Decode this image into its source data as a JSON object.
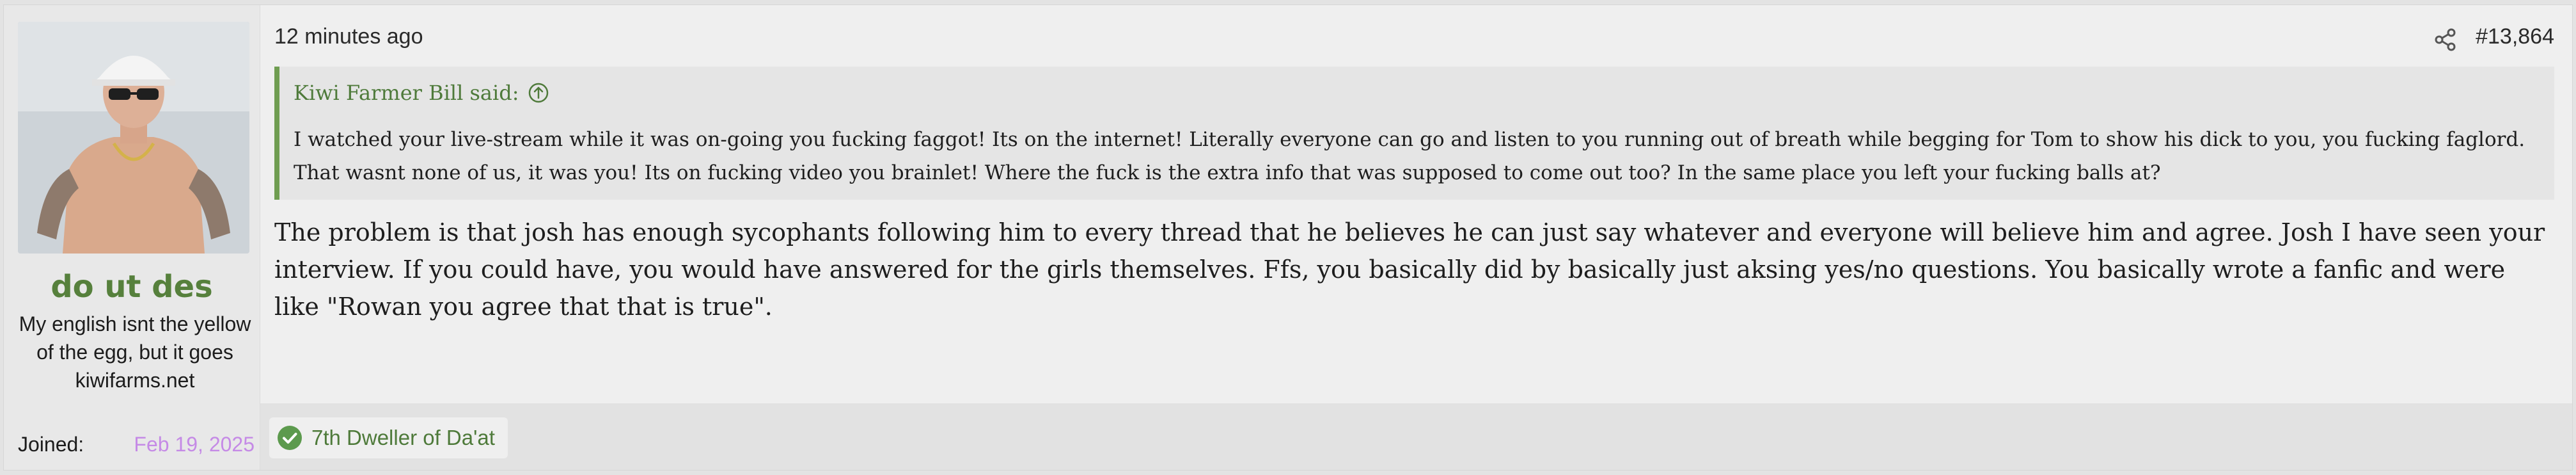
{
  "user": {
    "username": "do ut des",
    "user_title": "My english isnt the yellow of the egg, but it goes",
    "site": "kiwifarms.net",
    "joined_label": "Joined:",
    "joined_date": "Feb 19, 2025"
  },
  "post": {
    "time": "12 minutes ago",
    "number": "#13,864",
    "quote": {
      "author_line": "Kiwi Farmer Bill said:",
      "text": "I watched your live-stream while it was on-going you fucking faggot! Its on the internet! Literally everyone can go and listen to you running out of breath while begging for Tom to show his dick to you, you fucking faglord. That wasnt none of us, it was you! Its on fucking video you brainlet! Where the fuck is the extra info that was supposed to come out too? In the same place you left your fucking balls at?"
    },
    "body": "The problem is that josh has enough sycophants following him to every thread that he believes he can just say whatever and everyone will believe him and agree. Josh I have seen your interview. If you could have, you would have answered for the girls themselves. Ffs, you basically did by basically just aksing yes/no questions. You basically wrote a fanfic and were like \"Rowan you agree that that is true\".",
    "trophy_label": "7th Dweller of Da'at"
  },
  "icons": {
    "share": "share-icon",
    "quote_jump": "arrow-up-circle-icon",
    "trophy_check": "check-circle-icon"
  },
  "colors": {
    "username": "#56803c",
    "joined_date": "#c58ae6",
    "quote_border": "#6f9d51",
    "trophy_check": "#5c9a4d"
  }
}
